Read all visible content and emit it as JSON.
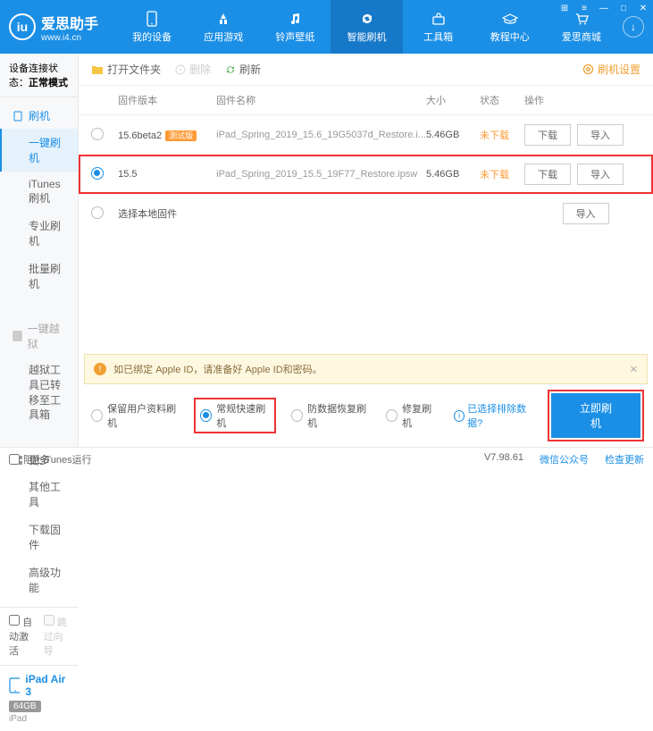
{
  "app": {
    "name": "爱思助手",
    "url": "www.i4.cn"
  },
  "nav": {
    "items": [
      {
        "label": "我的设备"
      },
      {
        "label": "应用游戏"
      },
      {
        "label": "铃声壁纸"
      },
      {
        "label": "智能刷机"
      },
      {
        "label": "工具箱"
      },
      {
        "label": "教程中心"
      },
      {
        "label": "爱思商城"
      }
    ],
    "active_index": 3
  },
  "sidebar": {
    "conn_label": "设备连接状态：",
    "conn_value": "正常模式",
    "groups": {
      "flash": {
        "title": "刷机",
        "items": [
          "一键刷机",
          "iTunes刷机",
          "专业刷机",
          "批量刷机"
        ],
        "active_index": 0
      },
      "jailbreak": {
        "title": "一键越狱",
        "items": [
          "越狱工具已转移至工具箱"
        ]
      },
      "more": {
        "title": "更多",
        "items": [
          "其他工具",
          "下载固件",
          "高级功能"
        ]
      }
    },
    "checks": {
      "auto_activate": "自动激活",
      "skip_guide": "跳过向导"
    },
    "device": {
      "name": "iPad Air 3",
      "storage": "64GB",
      "type": "iPad"
    }
  },
  "toolbar": {
    "open_folder": "打开文件夹",
    "delete": "删除",
    "refresh": "刷新",
    "settings": "刷机设置"
  },
  "table": {
    "headers": {
      "version": "固件版本",
      "name": "固件名称",
      "size": "大小",
      "status": "状态",
      "ops": "操作"
    },
    "ops": {
      "download": "下载",
      "import": "导入"
    },
    "rows": [
      {
        "version": "15.6beta2",
        "beta": "测试版",
        "name": "iPad_Spring_2019_15.6_19G5037d_Restore.i...",
        "size": "5.46GB",
        "status": "未下载",
        "selected": false
      },
      {
        "version": "15.5",
        "beta": "",
        "name": "iPad_Spring_2019_15.5_19F77_Restore.ipsw",
        "size": "5.46GB",
        "status": "未下载",
        "selected": true
      }
    ],
    "local_fw": "选择本地固件"
  },
  "notice": "如已绑定 Apple ID，请准备好 Apple ID和密码。",
  "modes": {
    "keep_data": "保留用户资料刷机",
    "normal": "常规快速刷机",
    "recovery": "防数据恢复刷机",
    "repair": "修复刷机",
    "exclude_link": "已选择排除数据?",
    "flash_btn": "立即刷机"
  },
  "footer": {
    "block_itunes": "阻止iTunes运行",
    "version": "V7.98.61",
    "wechat": "微信公众号",
    "check_update": "检查更新"
  }
}
